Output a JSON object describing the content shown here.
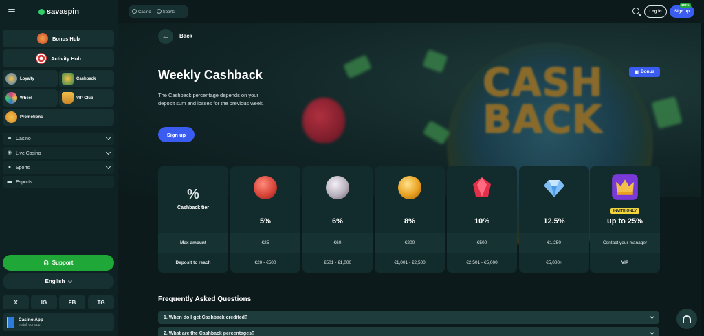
{
  "brand": {
    "name": "savaspin"
  },
  "sidebar": {
    "hubs": [
      {
        "label": "Bonus Hub",
        "icon": "fruit-icon"
      },
      {
        "label": "Activity Hub",
        "icon": "target-icon"
      }
    ],
    "tiles": [
      {
        "label": "Loyalty",
        "icon": "shield-icon"
      },
      {
        "label": "Cashback",
        "icon": "cash-icon"
      },
      {
        "label": "Wheel",
        "icon": "wheel-icon"
      },
      {
        "label": "VIP Club",
        "icon": "crown-icon"
      },
      {
        "label": "Promotions",
        "icon": "promo-icon"
      }
    ],
    "nav": [
      {
        "label": "Casino",
        "icon": "cherry-icon",
        "expandable": true
      },
      {
        "label": "Live Casino",
        "icon": "live-icon",
        "expandable": true
      },
      {
        "label": "Sports",
        "icon": "ball-icon",
        "expandable": true
      },
      {
        "label": "Esports",
        "icon": "gamepad-icon",
        "expandable": false
      }
    ],
    "support_label": "Support",
    "language_label": "English",
    "social": [
      "X",
      "IG",
      "FB",
      "TG"
    ],
    "app": {
      "title": "Casino App",
      "subtitle": "Install our app"
    }
  },
  "header": {
    "toggle": {
      "casino": "Casino",
      "sports": "Sports"
    },
    "login_label": "Log in",
    "signup_label": "Sign up",
    "signup_badge": "100%"
  },
  "hero": {
    "back_label": "Back",
    "title": "Weekly Cashback",
    "description": "The Cashback percentage depends on your deposit sum and losses for the previous week.",
    "signup_label": "Sign up",
    "bonus_label": "Bonus"
  },
  "table": {
    "header_symbol": "%",
    "header_label": "Cashback tier",
    "row_labels": {
      "max": "Max amount",
      "deposit": "Deposit to reach"
    },
    "tiers": [
      {
        "percent": "5%",
        "max": "€25",
        "deposit": "€20 - €500",
        "icon": "red-coin-icon",
        "color": "#d8463a"
      },
      {
        "percent": "6%",
        "max": "€60",
        "deposit": "€501 - €1,000",
        "icon": "silver-coin-icon",
        "color": "#b8b2bc"
      },
      {
        "percent": "8%",
        "max": "€200",
        "deposit": "€1,001 - €2,500",
        "icon": "gold-coin-icon",
        "color": "#e8a020"
      },
      {
        "percent": "10%",
        "max": "€500",
        "deposit": "€2,501 - €5,000",
        "icon": "ruby-icon",
        "color": "#e0304a"
      },
      {
        "percent": "12.5%",
        "max": "€1,250",
        "deposit": "€5,000+",
        "icon": "diamond-icon",
        "color": "#7fbff5"
      },
      {
        "percent": "up to 25%",
        "max": "Contact your manager",
        "deposit": "VIP",
        "icon": "crown-icon",
        "color": "#7a3ad8",
        "badge": "INVITE ONLY"
      }
    ]
  },
  "faq": {
    "title": "Frequently Asked Questions",
    "items": [
      "1.  When do I get Cashback credited?",
      "2.  What are the Cashback percentages?"
    ]
  }
}
